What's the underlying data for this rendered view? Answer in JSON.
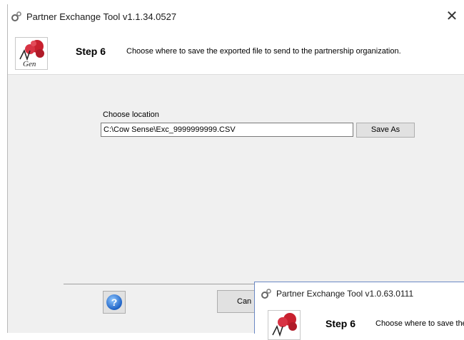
{
  "window": {
    "title": "Partner Exchange Tool v1.1.34.0527",
    "close_glyph": "✕"
  },
  "header": {
    "step": "Step 6",
    "description": "Choose where to save the exported file to send to the partnership organization."
  },
  "location": {
    "label": "Choose location",
    "value": "C:\\Cow Sense\\Exc_9999999999.CSV"
  },
  "buttons": {
    "save_as": "Save As",
    "help": "?",
    "cancel": "Can"
  },
  "overlay_window": {
    "title": "Partner Exchange Tool v1.0.63.0111",
    "step": "Step 6",
    "description": "Choose where to save the"
  },
  "logo_text": "Gen",
  "icons": {
    "app": "app-gear-icon",
    "close": "close-icon",
    "help": "help-icon",
    "logo": "company-logo"
  },
  "colors": {
    "logo_red": "#c8202e",
    "help_blue": "#1f63c6",
    "dialog_bg": "#f0f0f0"
  }
}
